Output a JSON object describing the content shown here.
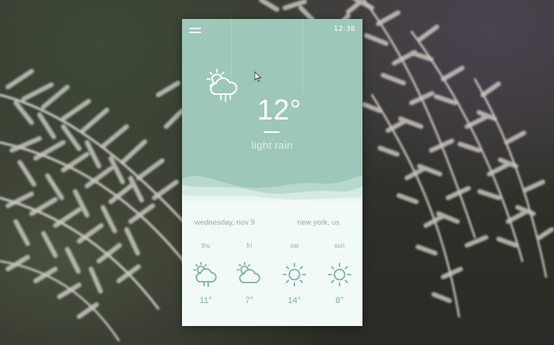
{
  "status_bar": {
    "time": "12:38"
  },
  "current": {
    "temperature": "12°",
    "condition": "light rain",
    "icon": "cloud-rain-sun-icon"
  },
  "info": {
    "date": "wednesday, nov 9",
    "location": "new york, us"
  },
  "forecast": [
    {
      "day": "thu",
      "temp": "11°",
      "icon": "cloud-rain-sun-icon"
    },
    {
      "day": "fri",
      "temp": "7°",
      "icon": "cloud-sun-icon"
    },
    {
      "day": "sat",
      "temp": "14°",
      "icon": "sun-icon"
    },
    {
      "day": "sun",
      "temp": "8°",
      "icon": "sun-icon"
    }
  ],
  "colors": {
    "panel_top": "#9dc7b8",
    "panel_bottom": "#f2faf8",
    "accent": "#7fb3a3",
    "muted_text": "#97a9a3"
  }
}
